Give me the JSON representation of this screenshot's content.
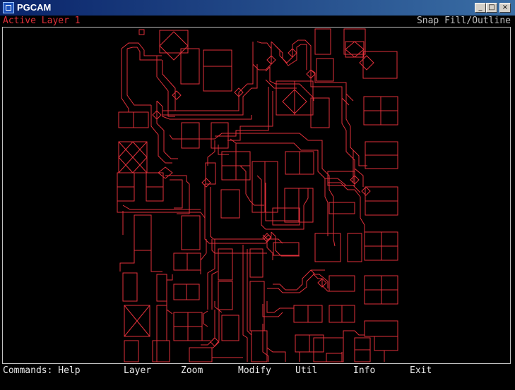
{
  "window": {
    "title": "PGCAM",
    "app_icon": "pgcam-app-icon",
    "title_gradient": [
      "#0a246a",
      "#3a6ea5"
    ]
  },
  "window_controls": {
    "minimize": "_",
    "maximize": "□",
    "close": "×"
  },
  "status": {
    "active_layer": "Active Layer 1",
    "snap_mode": "Snap Fill/Outline",
    "layer_color": "#e0303a"
  },
  "canvas": {
    "trace_color": "#e0303a",
    "frame_color": "#c0c0c0",
    "background": "#000000"
  },
  "commands": {
    "prompt": "Commands: Help",
    "layer": "Layer",
    "zoom": "Zoom",
    "modify": "Modify",
    "util": "Util",
    "info": "Info",
    "exit": "Exit"
  }
}
